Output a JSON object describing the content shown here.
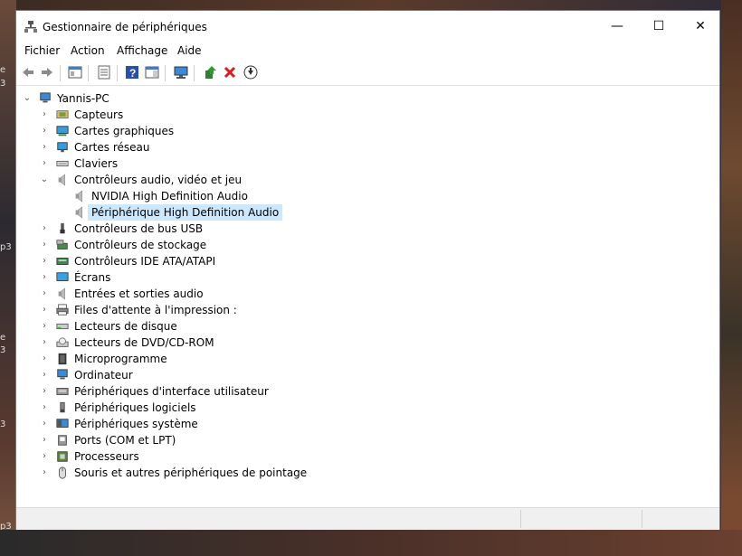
{
  "window": {
    "title": "Gestionnaire de périphériques"
  },
  "controls": {
    "minimize": "—",
    "maximize": "☐",
    "close": "✕"
  },
  "menu": [
    "Fichier",
    "Action",
    "Affichage",
    "Aide"
  ],
  "tree": {
    "root": "Yannis-PC",
    "items": [
      {
        "label": "Capteurs",
        "icon": "sensor-icon"
      },
      {
        "label": "Cartes graphiques",
        "icon": "display-adapter-icon"
      },
      {
        "label": "Cartes réseau",
        "icon": "network-adapter-icon"
      },
      {
        "label": "Claviers",
        "icon": "keyboard-icon"
      },
      {
        "label": "Contrôleurs audio, vidéo et jeu",
        "icon": "speaker-icon",
        "expanded": true,
        "children": [
          {
            "label": "NVIDIA High Definition Audio",
            "icon": "speaker-icon"
          },
          {
            "label": "Périphérique High Definition Audio",
            "icon": "speaker-icon",
            "selected": true
          }
        ]
      },
      {
        "label": "Contrôleurs de bus USB",
        "icon": "usb-icon"
      },
      {
        "label": "Contrôleurs de stockage",
        "icon": "storage-icon"
      },
      {
        "label": "Contrôleurs IDE ATA/ATAPI",
        "icon": "ide-icon"
      },
      {
        "label": "Écrans",
        "icon": "monitor-icon"
      },
      {
        "label": "Entrées et sorties audio",
        "icon": "speaker-icon"
      },
      {
        "label": "Files d'attente à l'impression :",
        "icon": "printer-icon"
      },
      {
        "label": "Lecteurs de disque",
        "icon": "disk-drive-icon"
      },
      {
        "label": "Lecteurs de DVD/CD-ROM",
        "icon": "dvd-icon"
      },
      {
        "label": "Microprogramme",
        "icon": "firmware-icon"
      },
      {
        "label": "Ordinateur",
        "icon": "computer-icon"
      },
      {
        "label": "Périphériques d'interface utilisateur",
        "icon": "hid-icon"
      },
      {
        "label": "Périphériques logiciels",
        "icon": "software-device-icon"
      },
      {
        "label": "Périphériques système",
        "icon": "system-device-icon"
      },
      {
        "label": "Ports (COM et LPT)",
        "icon": "port-icon"
      },
      {
        "label": "Processeurs",
        "icon": "processor-icon"
      },
      {
        "label": "Souris et autres périphériques de pointage",
        "icon": "mouse-icon"
      }
    ]
  },
  "desktop_fragments": [
    "e",
    "3",
    "p3",
    "e",
    "3",
    "p3",
    "3",
    "p3"
  ]
}
